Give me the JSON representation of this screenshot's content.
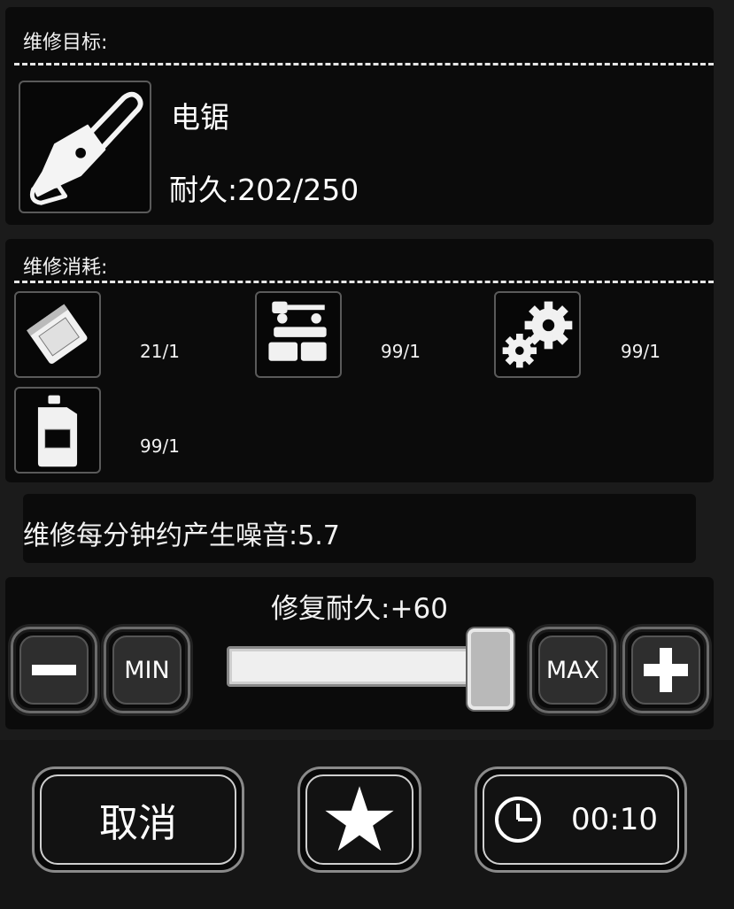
{
  "target": {
    "heading": "维修目标:",
    "item_name": "电锯",
    "durability_text": "耐久:202/250",
    "item_icon": "chainsaw-icon"
  },
  "consumption": {
    "heading": "维修消耗:",
    "items": [
      {
        "icon": "parts-bag-icon",
        "qty": "21/1"
      },
      {
        "icon": "scrap-parts-icon",
        "qty": "99/1"
      },
      {
        "icon": "gears-icon",
        "qty": "99/1"
      },
      {
        "icon": "jerrycan-icon",
        "qty": "99/1"
      }
    ]
  },
  "noise": {
    "text": "维修每分钟约产生噪音:5.7"
  },
  "repair": {
    "label": "修复耐久:+60",
    "min_label": "MIN",
    "max_label": "MAX",
    "slider_fraction": 1.0
  },
  "actions": {
    "cancel_label": "取消",
    "timer_text": "00:10",
    "star_icon": "star-icon",
    "clock_icon": "clock-icon"
  }
}
